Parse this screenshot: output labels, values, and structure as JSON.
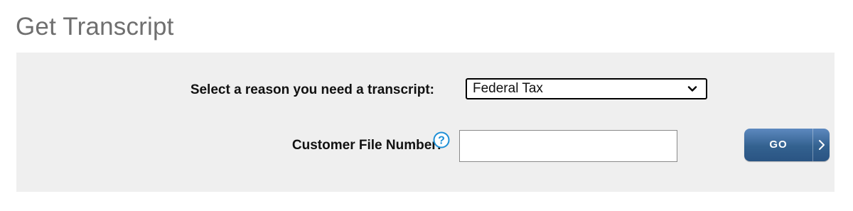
{
  "page": {
    "title": "Get Transcript"
  },
  "form": {
    "reason_label": "Select a reason you need a transcript:",
    "reason_selected": "Federal Tax",
    "file_number_label": "Customer File Number:",
    "file_number_value": "",
    "file_number_placeholder": "",
    "help_icon": "question-circle-icon",
    "go_label": "GO",
    "go_arrow_icon": "chevron-right-icon"
  },
  "colors": {
    "panel_background": "#efefef",
    "title_text": "#6f6f6f",
    "go_button": "#3a6899",
    "help_icon": "#1e8fd6"
  }
}
